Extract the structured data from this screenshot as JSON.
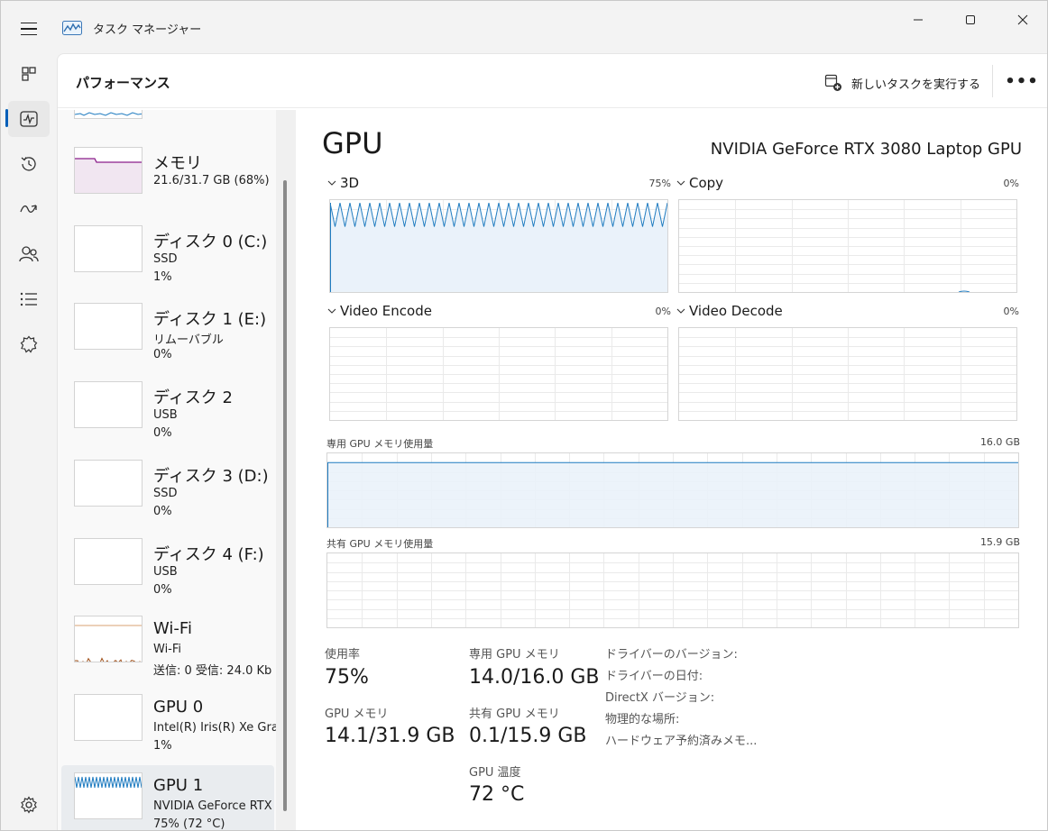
{
  "window": {
    "title": "タスク マネージャー",
    "accent": "#005fb8"
  },
  "nav": {
    "items": [
      {
        "name": "processes-icon"
      },
      {
        "name": "performance-icon",
        "active": true
      },
      {
        "name": "app-history-icon"
      },
      {
        "name": "startup-apps-icon"
      },
      {
        "name": "users-icon"
      },
      {
        "name": "details-icon"
      },
      {
        "name": "services-icon"
      }
    ],
    "settings": {
      "name": "settings-icon"
    }
  },
  "header": {
    "title": "パフォーマンス",
    "new_task_label": "新しいタスクを実行する",
    "more_label": "•••"
  },
  "resources": [
    {
      "name": "メモリ",
      "sub1": "21.6/31.7 GB (68%)",
      "sub2": "",
      "color": "#8b1d8b"
    },
    {
      "name": "ディスク 0 (C:)",
      "sub1": "SSD",
      "sub2": "1%",
      "color": "#4caf1a"
    },
    {
      "name": "ディスク 1 (E:)",
      "sub1": "リムーバブル",
      "sub2": "0%",
      "color": "#4caf1a"
    },
    {
      "name": "ディスク 2",
      "sub1": "USB",
      "sub2": "0%",
      "color": "#4caf1a"
    },
    {
      "name": "ディスク 3 (D:)",
      "sub1": "SSD",
      "sub2": "0%",
      "color": "#4caf1a"
    },
    {
      "name": "ディスク 4 (F:)",
      "sub1": "USB",
      "sub2": "0%",
      "color": "#4caf1a"
    },
    {
      "name": "Wi-Fi",
      "sub1": "Wi-Fi",
      "sub2": "送信: 0 受信: 24.0 Kb",
      "color": "#a0501a"
    },
    {
      "name": "GPU 0",
      "sub1": "Intel(R) Iris(R) Xe Gra",
      "sub2": "1%",
      "color": "#1e7bc0"
    },
    {
      "name": "GPU 1",
      "sub1": "NVIDIA GeForce RTX",
      "sub2": "75% (72 °C)",
      "color": "#1e7bc0",
      "selected": true
    }
  ],
  "gpu": {
    "title": "GPU",
    "model": "NVIDIA GeForce RTX 3080 Laptop GPU",
    "graph_color": "#1e7bc0",
    "engines": [
      {
        "label": "3D",
        "pct": "75%",
        "level": 0.75
      },
      {
        "label": "Copy",
        "pct": "0%",
        "level": 0
      },
      {
        "label": "Video Encode",
        "pct": "0%",
        "level": 0
      },
      {
        "label": "Video Decode",
        "pct": "0%",
        "level": 0
      }
    ],
    "dedicated_mem": {
      "label": "専用 GPU メモリ使用量",
      "max": "16.0 GB",
      "level": 0.875
    },
    "shared_mem": {
      "label": "共有 GPU メモリ使用量",
      "max": "15.9 GB",
      "level": 0.006
    },
    "stats": {
      "util_label": "使用率",
      "util_value": "75%",
      "gpu_mem_label": "GPU メモリ",
      "gpu_mem_value": "14.1/31.9 GB",
      "ded_label": "専用 GPU メモリ",
      "ded_value": "14.0/16.0 GB",
      "shared_label": "共有 GPU メモリ",
      "shared_value": "0.1/15.9 GB",
      "temp_label": "GPU 温度",
      "temp_value": "72 °C"
    },
    "info": {
      "driver_version": "ドライバーのバージョン:",
      "driver_date": "ドライバーの日付:",
      "directx": "DirectX バージョン:",
      "location": "物理的な場所:",
      "hw_reserved": "ハードウェア予約済みメモ..."
    }
  }
}
